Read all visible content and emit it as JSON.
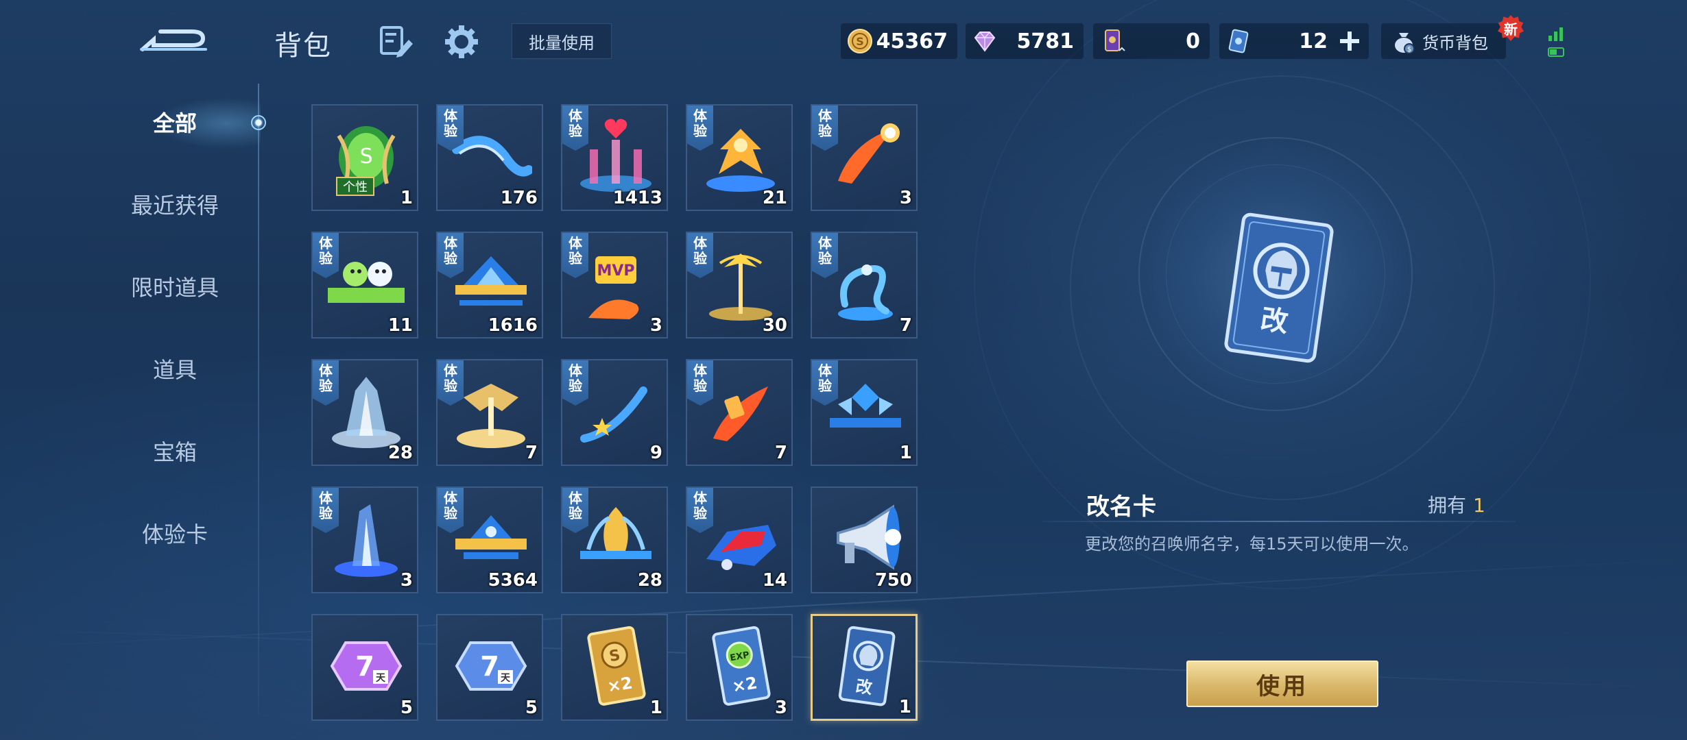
{
  "header": {
    "title": "背包",
    "batch_use_label": "批量使用",
    "currencies": [
      {
        "icon": "gold-coin-icon",
        "value": "45367"
      },
      {
        "icon": "diamond-icon",
        "value": "5781"
      },
      {
        "icon": "card-token-icon",
        "value": "0"
      },
      {
        "icon": "ticket-icon",
        "value": "12"
      }
    ],
    "wallet_label": "货币背包",
    "new_badge": "新"
  },
  "sidebar": {
    "items": [
      {
        "label": "全部",
        "active": true
      },
      {
        "label": "最近获得",
        "active": false
      },
      {
        "label": "限时道具",
        "active": false
      },
      {
        "label": "道具",
        "active": false
      },
      {
        "label": "宝箱",
        "active": false
      },
      {
        "label": "体验卡",
        "active": false
      }
    ]
  },
  "inventory": {
    "trial_tag": [
      "体",
      "验"
    ],
    "personality_label": "个性",
    "items": [
      {
        "name": "green-leaf-orb",
        "count": "1",
        "trial": false
      },
      {
        "name": "blue-trail",
        "count": "176",
        "trial": true
      },
      {
        "name": "heart-fountain",
        "count": "1413",
        "trial": true
      },
      {
        "name": "golden-phoenix",
        "count": "21",
        "trial": true
      },
      {
        "name": "fire-comet",
        "count": "3",
        "trial": true
      },
      {
        "name": "green-creatures-banner",
        "count": "11",
        "trial": true
      },
      {
        "name": "blue-crown-frame",
        "count": "1616",
        "trial": true
      },
      {
        "name": "mvp-effect",
        "count": "3",
        "trial": true
      },
      {
        "name": "golden-figure",
        "count": "30",
        "trial": true
      },
      {
        "name": "blue-dragon",
        "count": "7",
        "trial": true
      },
      {
        "name": "crystal-throne",
        "count": "28",
        "trial": true
      },
      {
        "name": "golden-wings-platform",
        "count": "7",
        "trial": true
      },
      {
        "name": "star-trail",
        "count": "9",
        "trial": true
      },
      {
        "name": "red-slash",
        "count": "7",
        "trial": true
      },
      {
        "name": "blue-wing-emblem",
        "count": "1",
        "trial": true
      },
      {
        "name": "blue-crystal-beam",
        "count": "3",
        "trial": true
      },
      {
        "name": "blue-gold-frame",
        "count": "5364",
        "trial": true
      },
      {
        "name": "golden-feather-frame",
        "count": "28",
        "trial": true
      },
      {
        "name": "red-blue-car",
        "count": "14",
        "trial": true
      },
      {
        "name": "megaphone",
        "count": "750",
        "trial": false
      },
      {
        "name": "purple-7day-card",
        "count": "5",
        "trial": false,
        "label": "7",
        "sublabel": "天"
      },
      {
        "name": "blue-7day-card",
        "count": "5",
        "trial": false,
        "label": "7",
        "sublabel": "天"
      },
      {
        "name": "gold-x2-card",
        "count": "1",
        "trial": false,
        "label": "×2"
      },
      {
        "name": "exp-x2-card",
        "count": "3",
        "trial": false,
        "label": "×2",
        "badge": "EXP"
      },
      {
        "name": "rename-card",
        "count": "1",
        "trial": false,
        "label": "改",
        "selected": true
      }
    ]
  },
  "detail": {
    "name": "改名卡",
    "owned_label": "拥有",
    "owned_count": "1",
    "description": "更改您的召唤师名字，每15天可以使用一次。",
    "card_label": "改",
    "use_label": "使用"
  },
  "colors": {
    "accent_gold": "#f0c762",
    "selected_border": "#e8cc8a",
    "trial_tag": "#3e78b8",
    "button_gold": "#d9b76a"
  }
}
